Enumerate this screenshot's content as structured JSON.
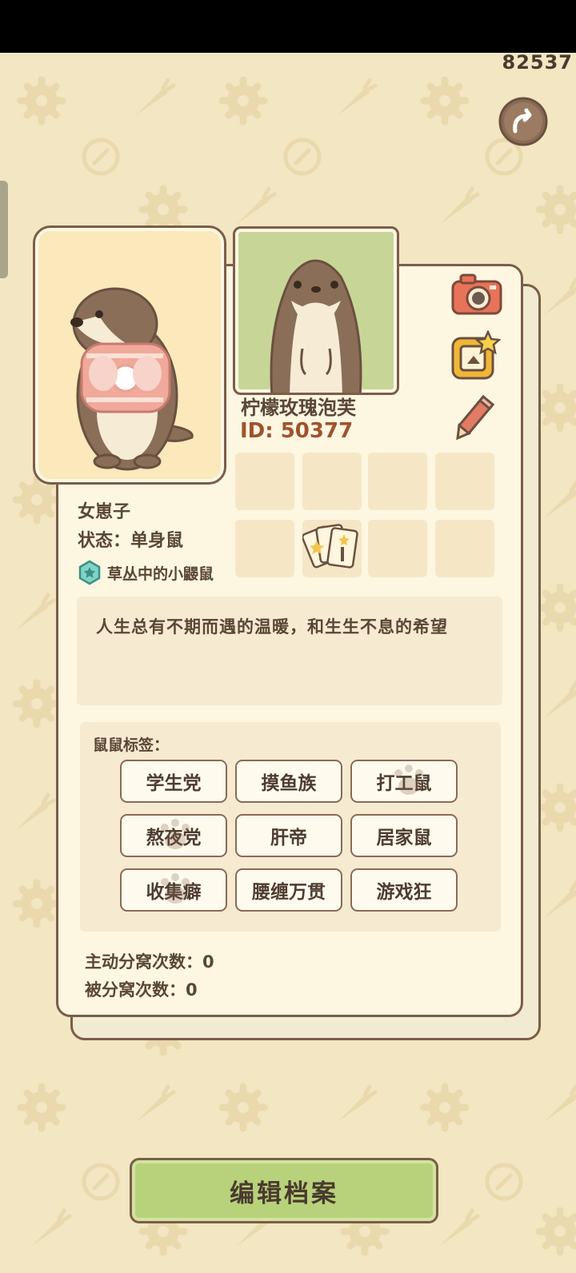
{
  "status_bar": {
    "counter": "82537"
  },
  "profile": {
    "nickname": "柠檬玫瑰泡芙",
    "id_label": "ID: 50377",
    "gender": "女崽子",
    "status": "状态：单身鼠",
    "badge": "草丛中的小鼹鼠",
    "bio": "人生总有不期而遇的温暖，和生生不息的希望"
  },
  "tags": {
    "title": "鼠鼠标签：",
    "items": [
      "学生党",
      "摸鱼族",
      "打工鼠",
      "熬夜党",
      "肝帝",
      "居家鼠",
      "收集癖",
      "腰缠万贯",
      "游戏狂"
    ]
  },
  "stats": {
    "active_split": "主动分窝次数：0",
    "passive_split": "被分窝次数：0"
  },
  "buttons": {
    "edit": "编辑档案"
  },
  "icons": {
    "back": "back-arrow-icon",
    "camera": "camera-icon",
    "frame": "frame-star-icon",
    "pencil": "pencil-icon",
    "badge": "star-badge-icon",
    "cards": "star-cards-icon"
  },
  "colors": {
    "background": "#f2e6c3",
    "card": "#fdf6e1",
    "border": "#7b5e48",
    "id_text": "#a0522d",
    "edit_button": "#b8d27c",
    "avatar_bg": "#c7d697",
    "portrait_bg": "#fbe8bb"
  }
}
